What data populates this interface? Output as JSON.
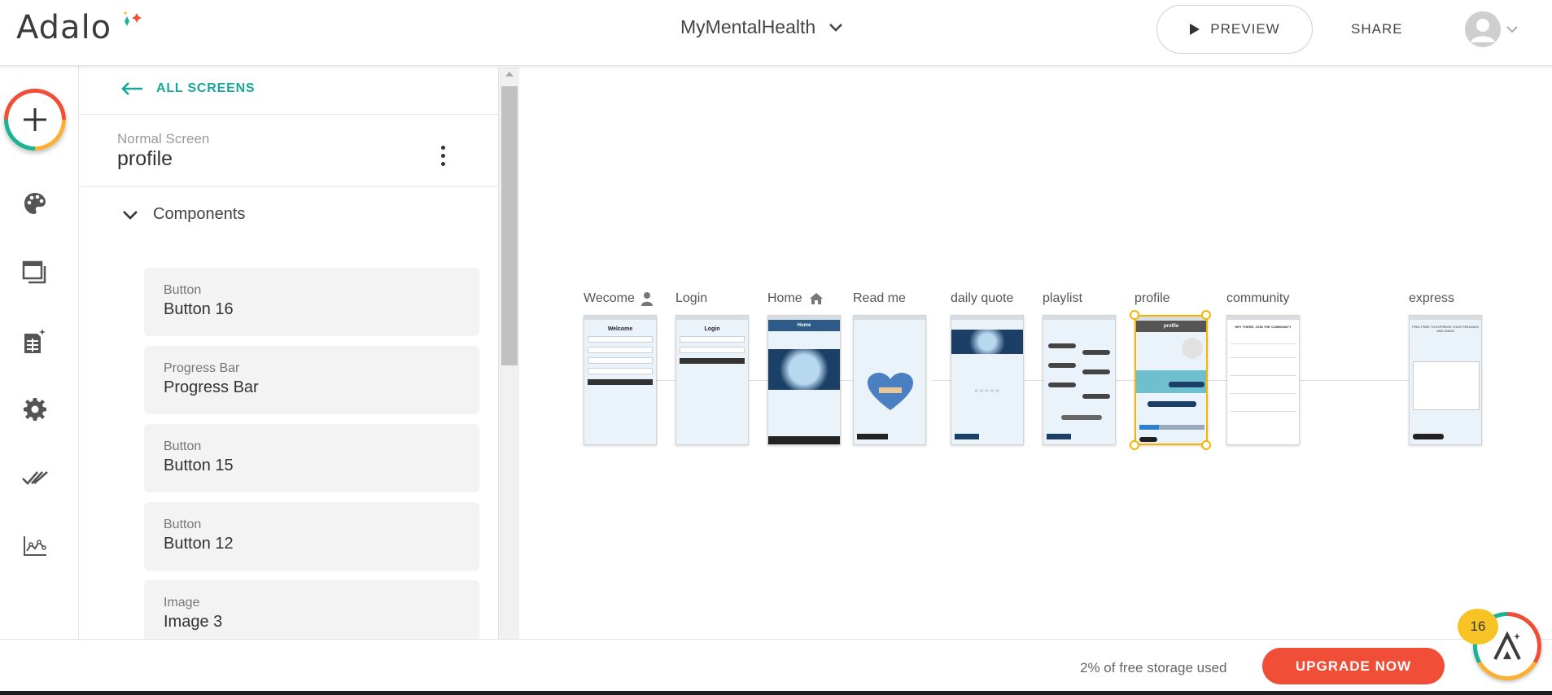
{
  "header": {
    "logo_text": "Adalo",
    "app_name": "MyMentalHealth",
    "preview_label": "PREVIEW",
    "share_label": "SHARE"
  },
  "rail": {
    "icons": [
      "add-icon",
      "palette-icon",
      "screens-icon",
      "database-icon",
      "settings-icon",
      "publish-icon",
      "analytics-icon"
    ]
  },
  "panel": {
    "back_label": "ALL SCREENS",
    "screen_type": "Normal Screen",
    "screen_name": "profile",
    "components_label": "Components",
    "components": [
      {
        "type": "Button",
        "name": "Button 16"
      },
      {
        "type": "Progress Bar",
        "name": "Progress Bar"
      },
      {
        "type": "Button",
        "name": "Button 15"
      },
      {
        "type": "Button",
        "name": "Button 12"
      },
      {
        "type": "Image",
        "name": "Image 3"
      }
    ]
  },
  "canvas": {
    "screens": [
      {
        "label": "Wecome"
      },
      {
        "label": "Login"
      },
      {
        "label": "Home"
      },
      {
        "label": "Read me"
      },
      {
        "label": "daily quote"
      },
      {
        "label": "playlist"
      },
      {
        "label": "profile"
      },
      {
        "label": "community"
      },
      {
        "label": "express"
      }
    ],
    "thumb_text": {
      "welcome_title": "Welcome",
      "login_title": "Login",
      "home_title": "Home",
      "profile_title": "profile",
      "community_title": "HEY THERE, JOIN THE COMMUNITY",
      "express_title": "FEEL FREE TO EXPRESS YOUR FEELINGS AND IDEAS"
    }
  },
  "footer": {
    "storage_text": "2% of free storage used",
    "upgrade_label": "UPGRADE NOW"
  },
  "help": {
    "badge_count": "16"
  },
  "colors": {
    "accent_teal": "#17a79a",
    "upgrade_red": "#f04e37",
    "selection_yellow": "#f7b500"
  }
}
